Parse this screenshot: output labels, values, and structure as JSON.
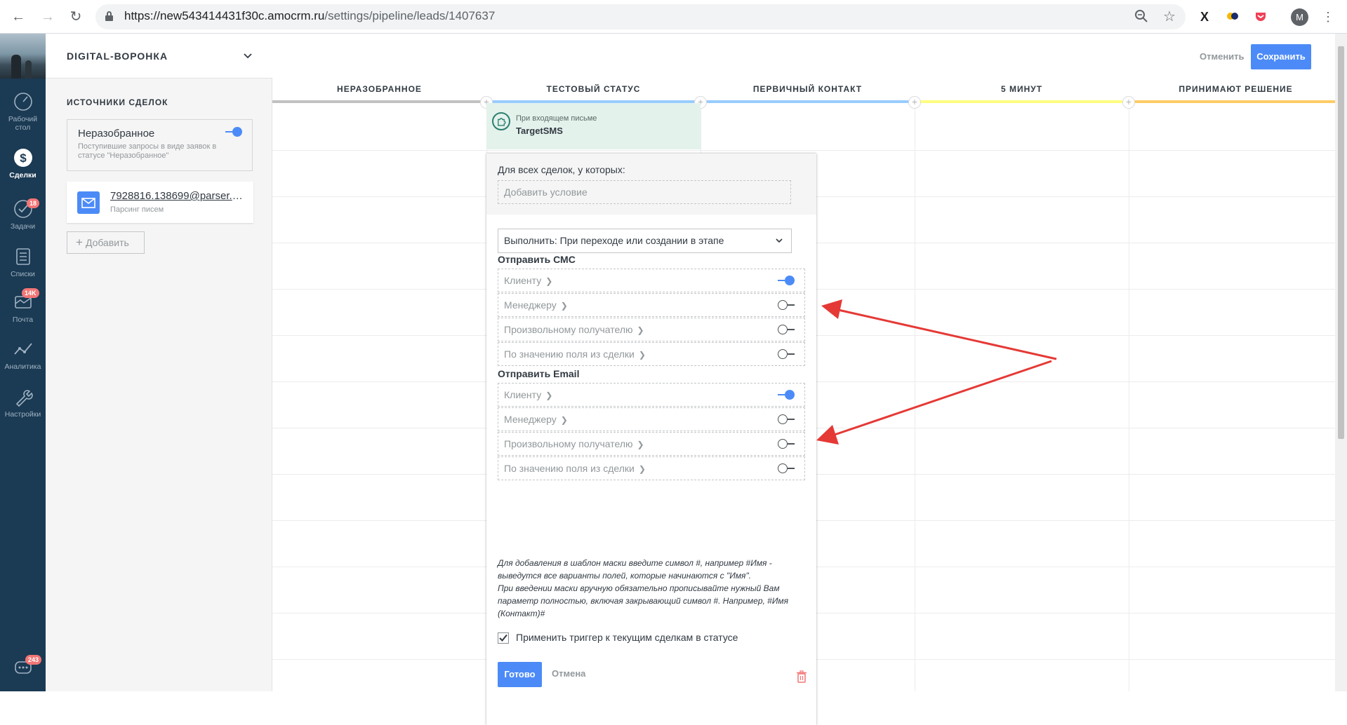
{
  "browser": {
    "url_host": "https://new543414431f30c.amocrm.ru",
    "url_path": "/settings/pipeline/leads/1407637",
    "profile_initial": "M"
  },
  "nav": {
    "items": [
      {
        "label": "Рабочий стол",
        "icon": "dashboard-icon"
      },
      {
        "label": "Сделки",
        "icon": "deals-icon"
      },
      {
        "label": "Задачи",
        "icon": "tasks-icon",
        "badge": "18"
      },
      {
        "label": "Списки",
        "icon": "lists-icon"
      },
      {
        "label": "Почта",
        "icon": "mail-icon",
        "badge": "14K"
      },
      {
        "label": "Аналитика",
        "icon": "analytics-icon"
      },
      {
        "label": "Настройки",
        "icon": "settings-icon"
      }
    ],
    "chat_badge": "243"
  },
  "sidebar": {
    "pipeline_name": "DIGITAL-ВОРОНКА",
    "sources_title": "ИСТОЧНИКИ СДЕЛОК",
    "source": {
      "name": "Неразобранное",
      "desc": "Поступившие запросы в виде заявок в статусе \"Неразобранное\"",
      "enabled": true
    },
    "email_source": {
      "address": "7928816.138699@parser.a...",
      "sub": "Парсинг писем"
    },
    "add_label": "Добавить"
  },
  "topbar": {
    "cancel": "Отменить",
    "save": "Сохранить"
  },
  "columns": [
    {
      "title": "НЕРАЗОБРАННОЕ",
      "color": "#c1c1c1"
    },
    {
      "title": "ТЕСТОВЫЙ СТАТУС",
      "color": "#99ccff"
    },
    {
      "title": "ПЕРВИЧНЫЙ КОНТАКТ",
      "color": "#99ccff"
    },
    {
      "title": "5 МИНУТ",
      "color": "#fffd7f"
    },
    {
      "title": "ПРИНИМАЮТ РЕШЕНИЕ",
      "color": "#ffcc66"
    }
  ],
  "trigger": {
    "label": "При входящем письме",
    "name": "TargetSMS"
  },
  "popup": {
    "cond_title": "Для всех сделок, у которых:",
    "cond_placeholder": "Добавить условие",
    "exec_value": "Выполнить: При переходе или создании в этапе",
    "sms_title": "Отправить СМС",
    "sms_options": [
      {
        "label": "Клиенту",
        "on": true
      },
      {
        "label": "Менеджеру",
        "on": false
      },
      {
        "label": "Произвольному получателю",
        "on": false
      },
      {
        "label": "По значению поля из сделки",
        "on": false
      }
    ],
    "email_title": "Отправить Email",
    "email_options": [
      {
        "label": "Клиенту",
        "on": true
      },
      {
        "label": "Менеджеру",
        "on": false
      },
      {
        "label": "Произвольному получателю",
        "on": false
      },
      {
        "label": "По значению поля из сделки",
        "on": false
      }
    ],
    "hint_1": "Для добавления в шаблон маски введите символ #, например #Имя - выведутся все варианты полей, которые начинаются с \"Имя\".",
    "hint_2": "При введении маски вручную обязательно прописывайте нужный Вам параметр полностью, включая закрывающий символ #. Например, #Имя (Контакт)#",
    "apply_label": "Применить триггер к текущим сделкам в статусе",
    "apply_checked": true,
    "done": "Готово",
    "cancel": "Отмена"
  },
  "colors": {
    "accent": "#4c8bf7",
    "nav_bg": "#1b3a53",
    "annotation_arrow": "#e53935"
  }
}
